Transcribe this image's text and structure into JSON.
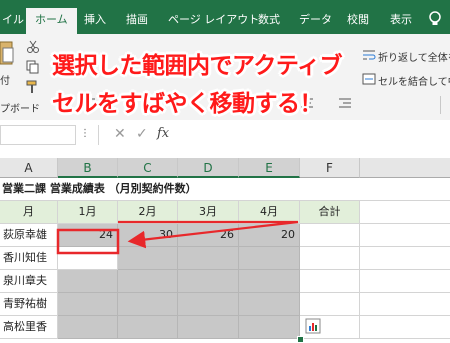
{
  "ribbon_tabs": {
    "file_partial": "イル",
    "home": "ホーム",
    "insert": "挿入",
    "draw": "描画",
    "page_layout": "ページ レイアウト",
    "formulas": "数式",
    "data": "データ",
    "review": "校閲",
    "view": "表示"
  },
  "ribbon": {
    "wrap_text": "折り返して全体を表",
    "merge_center": "セルを結合して中央",
    "clipboard_partial": "プボード",
    "paste_partial": "付"
  },
  "formula_bar": {
    "fx": "fx"
  },
  "columns": [
    "A",
    "B",
    "C",
    "D",
    "E",
    "F"
  ],
  "sheet": {
    "title": "営業二課 営業成績表 （月別契約件数）",
    "header_row": {
      "a": "月",
      "b": "1月",
      "c": "2月",
      "d": "3月",
      "e": "4月",
      "f": "合計"
    },
    "rows": [
      {
        "name": "荻原幸雄",
        "b": "24",
        "c": "30",
        "d": "26",
        "e": "20"
      },
      {
        "name": "香川知佳",
        "b": "",
        "c": "",
        "d": "",
        "e": ""
      },
      {
        "name": "泉川章夫",
        "b": "",
        "c": "",
        "d": "",
        "e": ""
      },
      {
        "name": "青野祐樹",
        "b": "",
        "c": "",
        "d": "",
        "e": ""
      },
      {
        "name": "高松里香",
        "b": "",
        "c": "",
        "d": "",
        "e": ""
      }
    ]
  },
  "overlay": {
    "line1": "選択した範囲内でアクティブ",
    "line2": "セルをすばやく移動する！"
  },
  "colors": {
    "excel_green": "#217346",
    "annotation_red": "#e8282b",
    "selection_gray": "#c8c8c8",
    "header_fill": "#e2efda"
  }
}
